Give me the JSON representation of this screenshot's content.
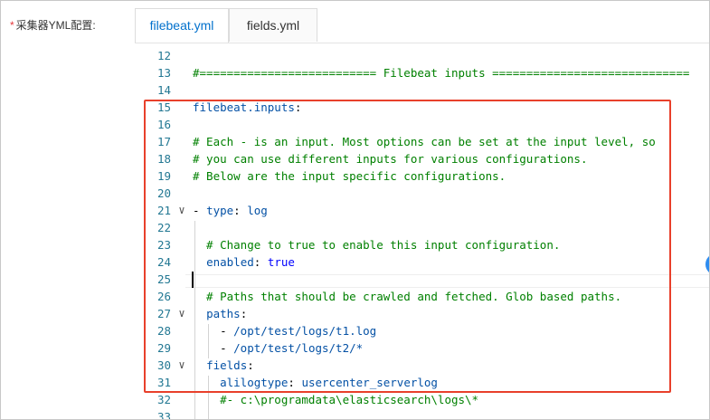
{
  "form": {
    "required_mark": "*",
    "label": "采集器YML配置:"
  },
  "tabs": [
    {
      "label": "filebeat.yml",
      "active": true
    },
    {
      "label": "fields.yml",
      "active": false
    }
  ],
  "editor": {
    "lines": [
      {
        "n": "12",
        "fold": "",
        "tokens": []
      },
      {
        "n": "13",
        "fold": "",
        "tokens": [
          {
            "t": "#========================== Filebeat inputs =============================",
            "c": "comment"
          }
        ]
      },
      {
        "n": "14",
        "fold": "",
        "tokens": []
      },
      {
        "n": "15",
        "fold": "",
        "tokens": [
          {
            "t": "filebeat.inputs",
            "c": "key"
          },
          {
            "t": ":",
            "c": "punct"
          }
        ]
      },
      {
        "n": "16",
        "fold": "",
        "tokens": []
      },
      {
        "n": "17",
        "fold": "",
        "tokens": [
          {
            "t": "# Each - is an input. Most options can be set at the input level, so",
            "c": "comment"
          }
        ]
      },
      {
        "n": "18",
        "fold": "",
        "tokens": [
          {
            "t": "# you can use different inputs for various configurations.",
            "c": "comment"
          }
        ]
      },
      {
        "n": "19",
        "fold": "",
        "tokens": [
          {
            "t": "# Below are the input specific configurations.",
            "c": "comment"
          }
        ]
      },
      {
        "n": "20",
        "fold": "",
        "tokens": []
      },
      {
        "n": "21",
        "fold": "v",
        "tokens": [
          {
            "t": "- ",
            "c": "plain"
          },
          {
            "t": "type",
            "c": "key"
          },
          {
            "t": ": ",
            "c": "punct"
          },
          {
            "t": "log",
            "c": "key"
          }
        ]
      },
      {
        "n": "22",
        "fold": "",
        "tokens": []
      },
      {
        "n": "23",
        "fold": "",
        "tokens": [
          {
            "t": "  # Change to true to enable this input configuration.",
            "c": "comment"
          }
        ]
      },
      {
        "n": "24",
        "fold": "",
        "tokens": [
          {
            "t": "  ",
            "c": "plain"
          },
          {
            "t": "enabled",
            "c": "key"
          },
          {
            "t": ": ",
            "c": "punct"
          },
          {
            "t": "true",
            "c": "value"
          }
        ]
      },
      {
        "n": "25",
        "fold": "",
        "tokens": []
      },
      {
        "n": "26",
        "fold": "",
        "tokens": [
          {
            "t": "  # Paths that should be crawled and fetched. Glob based paths.",
            "c": "comment"
          }
        ]
      },
      {
        "n": "27",
        "fold": "v",
        "tokens": [
          {
            "t": "  ",
            "c": "plain"
          },
          {
            "t": "paths",
            "c": "key"
          },
          {
            "t": ":",
            "c": "punct"
          }
        ]
      },
      {
        "n": "28",
        "fold": "",
        "tokens": [
          {
            "t": "    - ",
            "c": "plain"
          },
          {
            "t": "/opt/test/logs/t1.log",
            "c": "key"
          }
        ]
      },
      {
        "n": "29",
        "fold": "",
        "tokens": [
          {
            "t": "    - ",
            "c": "plain"
          },
          {
            "t": "/opt/test/logs/t2/*",
            "c": "key"
          }
        ]
      },
      {
        "n": "30",
        "fold": "v",
        "tokens": [
          {
            "t": "  ",
            "c": "plain"
          },
          {
            "t": "fields",
            "c": "key"
          },
          {
            "t": ":",
            "c": "punct"
          }
        ]
      },
      {
        "n": "31",
        "fold": "",
        "tokens": [
          {
            "t": "    ",
            "c": "plain"
          },
          {
            "t": "alilogtype",
            "c": "key"
          },
          {
            "t": ": ",
            "c": "punct"
          },
          {
            "t": "usercenter_serverlog",
            "c": "key"
          }
        ]
      },
      {
        "n": "32",
        "fold": "",
        "tokens": [
          {
            "t": "    #- c:\\programdata\\elasticsearch\\logs\\*",
            "c": "comment"
          }
        ]
      },
      {
        "n": "33",
        "fold": "",
        "tokens": []
      }
    ]
  },
  "colors": {
    "highlight_border": "#e8402b",
    "active_tab_text": "#0070cc",
    "line_number": "#237893",
    "comment": "#008000"
  }
}
